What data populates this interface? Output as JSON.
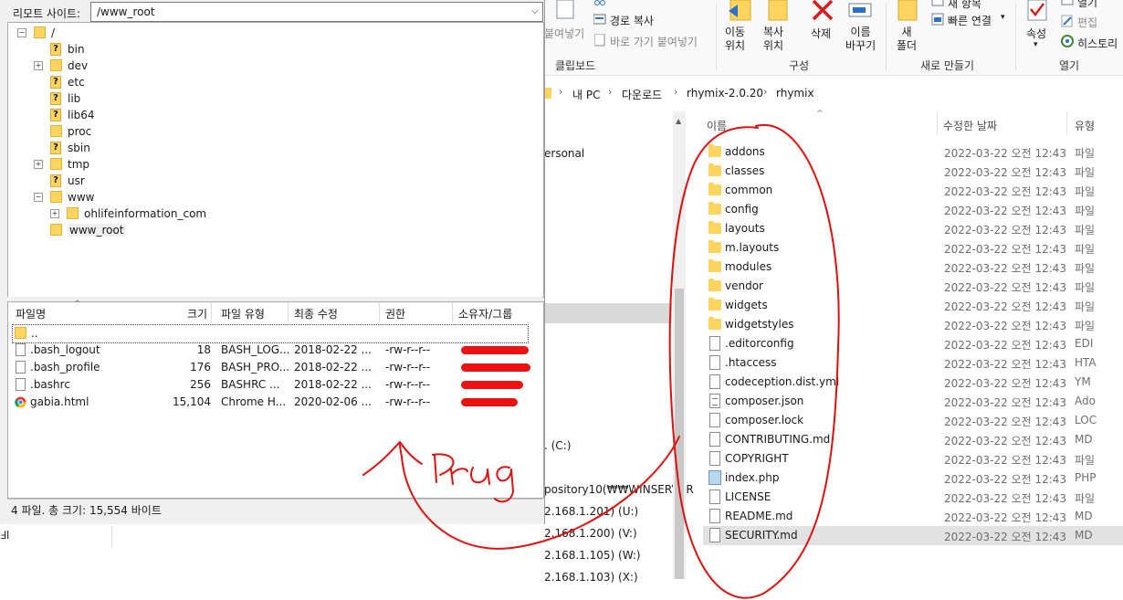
{
  "filezilla": {
    "remote_site_label": "리모트 사이트:",
    "remote_site_value": "/www_root",
    "tree": [
      {
        "label": "/",
        "icon": "folder-icon",
        "expander": "−"
      },
      {
        "label": "bin",
        "icon": "unknown-folder-icon",
        "expander": ""
      },
      {
        "label": "dev",
        "icon": "folder-icon",
        "expander": "+"
      },
      {
        "label": "etc",
        "icon": "unknown-folder-icon",
        "expander": ""
      },
      {
        "label": "lib",
        "icon": "unknown-folder-icon",
        "expander": ""
      },
      {
        "label": "lib64",
        "icon": "unknown-folder-icon",
        "expander": ""
      },
      {
        "label": "proc",
        "icon": "folder-icon",
        "expander": ""
      },
      {
        "label": "sbin",
        "icon": "unknown-folder-icon",
        "expander": ""
      },
      {
        "label": "tmp",
        "icon": "folder-icon",
        "expander": "+"
      },
      {
        "label": "usr",
        "icon": "unknown-folder-icon",
        "expander": ""
      },
      {
        "label": "www",
        "icon": "folder-icon",
        "expander": "−"
      },
      {
        "label": "ohlifeinformation_com",
        "icon": "folder-icon",
        "expander": "+"
      },
      {
        "label": "www_root",
        "icon": "folder-icon",
        "expander": ""
      }
    ],
    "list_headers": [
      "파일명",
      "크기",
      "파일 유형",
      "최종 수정",
      "권한",
      "소유자/그룹"
    ],
    "files": [
      {
        "name": "..",
        "size": "",
        "type": "",
        "modified": "",
        "perm": "",
        "owner": ""
      },
      {
        "name": ".bash_logout",
        "size": "18",
        "type": "BASH_LOG...",
        "modified": "2018-02-22 ...",
        "perm": "-rw-r--r--",
        "owner": ""
      },
      {
        "name": ".bash_profile",
        "size": "176",
        "type": "BASH_PRO...",
        "modified": "2018-02-22 ...",
        "perm": "-rw-r--r--",
        "owner": ""
      },
      {
        "name": ".bashrc",
        "size": "256",
        "type": "BASHRC ...",
        "modified": "2018-02-22 ...",
        "perm": "-rw-r--r--",
        "owner": ""
      },
      {
        "name": "gabia.html",
        "size": "15,104",
        "type": "Chrome H...",
        "modified": "2020-02-06 ...",
        "perm": "-rw-r--r--",
        "owner": ""
      }
    ],
    "status": "4 파일. 총 크기: 15,554 바이트"
  },
  "explorer": {
    "ribbon": {
      "paste": "붙여넣기",
      "copy_path": "경로 복사",
      "paste_shortcut": "바로 가기 붙여넣기",
      "move_to": "이동\n위치",
      "copy_to": "복사\n위치",
      "delete": "삭제",
      "rename": "이름\n바꾸기",
      "new_folder": "새\n폴더",
      "easy_access": "빠른 연결",
      "new_item": "새 항목",
      "properties": "속성",
      "edit": "편집",
      "history": "히스토리",
      "open_top": "열기",
      "groups": [
        "클립보드",
        "구성",
        "새로 만들기",
        "열기"
      ]
    },
    "breadcrumb": [
      "내 PC",
      "다운로드",
      "rhymix-2.0.20",
      "rhymix"
    ],
    "nav_items": [
      "ersonal",
      ". (C:)",
      "pository10(₩₩WINSERVER",
      "2.168.1.201) (U:)",
      "2.168.1.200) (V:)",
      "2.168.1.105) (W:)",
      "2.168.1.103) (X:)"
    ],
    "columns": {
      "name": "이름",
      "date": "수정한 날짜",
      "type": "유형"
    },
    "files": [
      {
        "name": "addons",
        "date": "2022-03-22 오전 12:43",
        "type": "파일",
        "icon": "folder-icon"
      },
      {
        "name": "classes",
        "date": "2022-03-22 오전 12:43",
        "type": "파일",
        "icon": "folder-icon"
      },
      {
        "name": "common",
        "date": "2022-03-22 오전 12:43",
        "type": "파일",
        "icon": "folder-icon"
      },
      {
        "name": "config",
        "date": "2022-03-22 오전 12:43",
        "type": "파일",
        "icon": "folder-icon"
      },
      {
        "name": "layouts",
        "date": "2022-03-22 오전 12:43",
        "type": "파일",
        "icon": "folder-icon"
      },
      {
        "name": "m.layouts",
        "date": "2022-03-22 오전 12:43",
        "type": "파일",
        "icon": "folder-icon"
      },
      {
        "name": "modules",
        "date": "2022-03-22 오전 12:43",
        "type": "파일",
        "icon": "folder-icon"
      },
      {
        "name": "vendor",
        "date": "2022-03-22 오전 12:43",
        "type": "파일",
        "icon": "folder-icon"
      },
      {
        "name": "widgets",
        "date": "2022-03-22 오전 12:43",
        "type": "파일",
        "icon": "folder-icon"
      },
      {
        "name": "widgetstyles",
        "date": "2022-03-22 오전 12:43",
        "type": "파일",
        "icon": "folder-icon"
      },
      {
        "name": ".editorconfig",
        "date": "2022-03-22 오전 12:43",
        "type": "EDI",
        "icon": "file-icon"
      },
      {
        "name": ".htaccess",
        "date": "2022-03-22 오전 12:43",
        "type": "HTA",
        "icon": "file-icon"
      },
      {
        "name": "codeception.dist.yml",
        "date": "2022-03-22 오전 12:43",
        "type": "YM",
        "icon": "file-icon"
      },
      {
        "name": "composer.json",
        "date": "2022-03-22 오전 12:43",
        "type": "Ado",
        "icon": "json-file-icon"
      },
      {
        "name": "composer.lock",
        "date": "2022-03-22 오전 12:43",
        "type": "LOC",
        "icon": "file-icon"
      },
      {
        "name": "CONTRIBUTING.md",
        "date": "2022-03-22 오전 12:43",
        "type": "MD",
        "icon": "file-icon"
      },
      {
        "name": "COPYRIGHT",
        "date": "2022-03-22 오전 12:43",
        "type": "파일",
        "icon": "file-icon"
      },
      {
        "name": "index.php",
        "date": "2022-03-22 오전 12:43",
        "type": "PHP",
        "icon": "php-file-icon"
      },
      {
        "name": "LICENSE",
        "date": "2022-03-22 오전 12:43",
        "type": "파일",
        "icon": "file-icon"
      },
      {
        "name": "README.md",
        "date": "2022-03-22 오전 12:43",
        "type": "MD",
        "icon": "file-icon"
      },
      {
        "name": "SECURITY.md",
        "date": "2022-03-22 오전 12:43",
        "type": "MD",
        "icon": "file-icon"
      }
    ],
    "selected_file": "SECURITY.md"
  },
  "annotation": {
    "text": "Drug",
    "color": "#e01010"
  }
}
